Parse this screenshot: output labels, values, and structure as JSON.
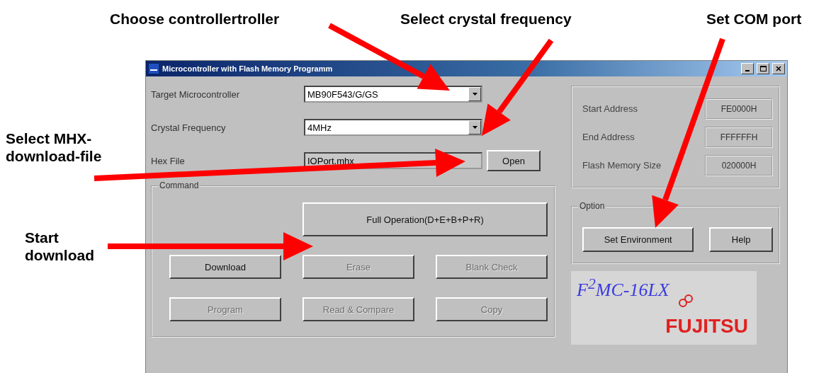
{
  "annotations": [
    {
      "text": "Choose controllertroller"
    },
    {
      "text": "Select crystal frequency"
    },
    {
      "text": "Set COM port"
    },
    {
      "text": "Select MHX-\ndownload-file"
    },
    {
      "text": "Start\ndownload"
    }
  ],
  "window": {
    "title": "Microcontroller with Flash Memory Programm"
  },
  "fields": [
    {
      "label": "Target Microcontroller",
      "value": "MB90F543/G/GS",
      "kind": "combo"
    },
    {
      "label": "Crystal Frequency",
      "value": "4MHz",
      "kind": "combo"
    },
    {
      "label": "Hex File",
      "value": "IOPort.mhx",
      "kind": "file",
      "button": "Open"
    }
  ],
  "info": [
    {
      "label": "Start Address",
      "value": "FE0000H"
    },
    {
      "label": "End Address",
      "value": "FFFFFFH"
    },
    {
      "label": "Flash Memory Size",
      "value": "020000H"
    }
  ],
  "command": {
    "title": "Command",
    "main_button": {
      "label": "Full Operation(D+E+B+P+R)",
      "disabled": false
    },
    "buttons": [
      {
        "label": "Download",
        "disabled": false
      },
      {
        "label": "Erase",
        "disabled": true
      },
      {
        "label": "Blank Check",
        "disabled": true
      },
      {
        "label": "Program",
        "disabled": true
      },
      {
        "label": "Read & Compare",
        "disabled": true
      },
      {
        "label": "Copy",
        "disabled": true
      }
    ]
  },
  "option": {
    "title": "Option",
    "buttons": [
      "Set Environment",
      "Help"
    ]
  },
  "logo": {
    "product": "F$^{2}$MC-16LX",
    "brand": "FUJITSU"
  }
}
